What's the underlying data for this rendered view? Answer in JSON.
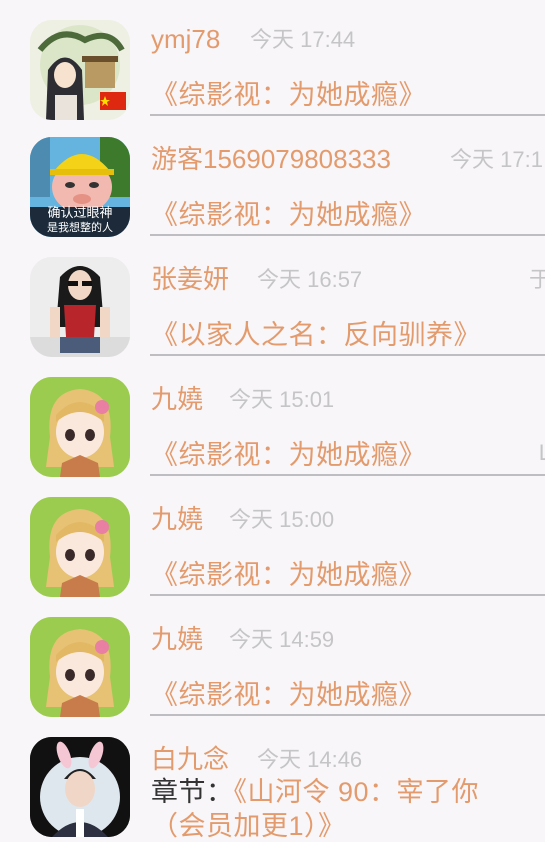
{
  "messages": [
    {
      "name": "ymj78",
      "time": "今天 17:44",
      "book": "《综影视：为她成瘾》",
      "tag": ""
    },
    {
      "name": "游客1569079808333",
      "time": "今天 17:1",
      "book": "《综影视：为她成瘾》",
      "tag": ""
    },
    {
      "name": "张姜妍",
      "time": "今天 16:57",
      "book": "《以家人之名：反向驯养》",
      "tag": "于"
    },
    {
      "name": "九嬈",
      "time": "今天 15:01",
      "book": "《综影视：为她成瘾》",
      "tag": "L"
    },
    {
      "name": "九嬈",
      "time": "今天 15:00",
      "book": "《综影视：为她成瘾》",
      "tag": ""
    },
    {
      "name": "九嬈",
      "time": "今天 14:59",
      "book": "《综影视：为她成瘾》",
      "tag": ""
    },
    {
      "name": "白九念",
      "time": "今天 14:46",
      "chapter_prefix": "章节：",
      "book": "《山河令 90：宰了你",
      "book_line2": "（会员加更1）》",
      "tag": ""
    }
  ],
  "avatar2_caption_line1": "确认过眼神",
  "avatar2_caption_line2": "是我想整的人",
  "colors": {
    "accent": "#e39b6d",
    "muted": "#c5c5c8",
    "divider": "#bdbdc2",
    "background": "#f8f6f8",
    "avatar_green": "#9ccc4f"
  }
}
